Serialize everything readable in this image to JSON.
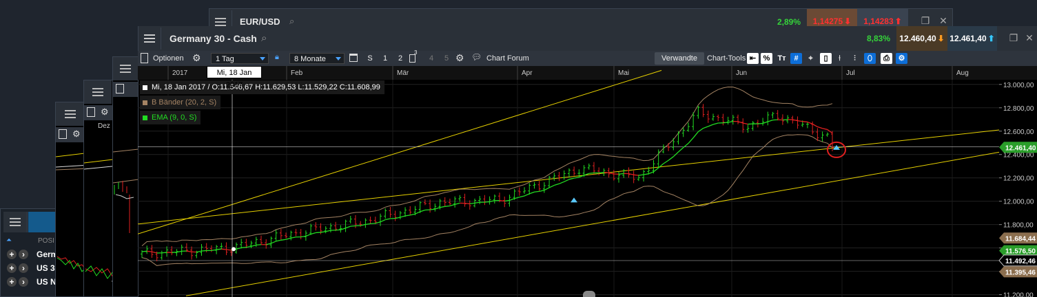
{
  "back_window": {
    "symbol": "EUR/USD",
    "change_pct": "2,89%",
    "bid": "1,14275",
    "ask": "1,14283"
  },
  "left_panel": {
    "column_label": "POSI",
    "rows": [
      "Germ",
      "US 3",
      "US N"
    ],
    "month_label": "Dez"
  },
  "main_window": {
    "title": "Germany 30 - Cash",
    "change_pct": "8,83%",
    "bid": "12.460,40",
    "ask": "12.461,40"
  },
  "toolbar": {
    "options_label": "Optionen",
    "interval_value": "1 Tag",
    "range_value": "8 Monate",
    "count_buttons": [
      "S",
      "1",
      "2",
      "3",
      "4",
      "5"
    ],
    "forum_label": "Chart Forum",
    "related_label": "Verwandte",
    "tools_label": "Chart-Tools"
  },
  "legend": {
    "ohlc": "Mi, 18 Jan 2017 / O:11.546,67   H:11.629,53   L:11.529,22   C:11.608,99",
    "bollinger": "B Bänder (20, 2, S)",
    "ema": "EMA (9, 0, S)"
  },
  "crosshair_date": "Mi, 18 Jan 2017",
  "colors": {
    "up": "#22dd22",
    "down": "#e02020",
    "bollinger": "#a58464",
    "ema": "#22dd22",
    "trendline": "#e8d200",
    "positive": "#35d33a",
    "negative": "#ff3030"
  },
  "chart_data": {
    "type": "line",
    "x_axis_labels": [
      "2017",
      "Feb",
      "Mär",
      "Apr",
      "Mai",
      "Jun",
      "Jul",
      "Aug"
    ],
    "y_axis_labels": [
      "13.000,00",
      "12.800,00",
      "12.600,00",
      "12.400,00",
      "12.200,00",
      "12.000,00",
      "11.800,00",
      "11.600,00",
      "11.400,00",
      "11.200,00"
    ],
    "ylim": [
      11180,
      13040
    ],
    "price_tags": [
      {
        "label": "12.461,40",
        "value": 12461.4,
        "style": "green"
      },
      {
        "label": "11.684,44",
        "value": 11684.44,
        "style": "tan"
      },
      {
        "label": "11.576,50",
        "value": 11576.5,
        "style": "green"
      },
      {
        "label": "11.492,46",
        "value": 11492.46,
        "style": "white"
      },
      {
        "label": "11.395,46",
        "value": 11395.46,
        "style": "tan"
      }
    ],
    "series": [
      {
        "name": "EMA (9, 0, S)",
        "values": [
          11550,
          11600,
          11700,
          11770,
          11860,
          11940,
          12000,
          12000,
          12080,
          12190,
          12220,
          12150,
          12500,
          12730,
          12720,
          12680,
          12710,
          12720,
          12700
        ]
      },
      {
        "name": "B Bänder (20, 2, S)",
        "values": [
          11760,
          11820,
          11950,
          12010,
          12080,
          12140,
          12200,
          12250,
          12250,
          12330,
          12480,
          12660,
          12900,
          13060,
          12920,
          12900,
          12900,
          12900,
          12870
        ]
      }
    ]
  }
}
